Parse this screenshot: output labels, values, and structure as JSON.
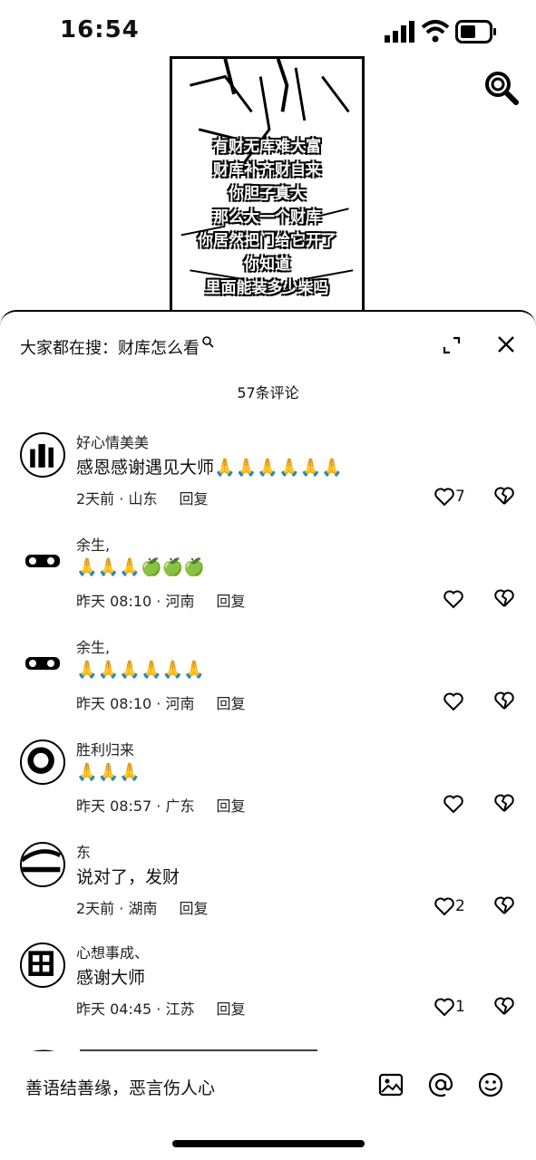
{
  "status_bar": {
    "time": "16:54"
  },
  "video": {
    "captions": [
      "有财无库难大富",
      "财库补齐财自来",
      "你胆子真大",
      "那么大一个财库",
      "你居然把门给它开了",
      "你知道",
      "里面能装多少柴吗"
    ]
  },
  "sheet": {
    "suggest_prefix": "大家都在搜：",
    "suggest_query": "财库怎么看",
    "comment_count": "57条评论",
    "comments": [
      {
        "user": "好心情美美",
        "text": "感恩感谢遇见大师🙏🙏🙏🙏🙏🙏",
        "time_loc": "2天前 · 山东",
        "reply": "回复",
        "likes": "7"
      },
      {
        "user": "余生,",
        "text": "🙏🙏🙏🍏🍏🍏",
        "time_loc": "昨天 08:10 · 河南",
        "reply": "回复",
        "likes": ""
      },
      {
        "user": "余生,",
        "text": "🙏🙏🙏🙏🙏🙏",
        "time_loc": "昨天 08:10 · 河南",
        "reply": "回复",
        "likes": ""
      },
      {
        "user": "胜利归来",
        "text": "🙏🙏🙏",
        "time_loc": "昨天 08:57 · 广东",
        "reply": "回复",
        "likes": ""
      },
      {
        "user": "东",
        "text": "说对了，发财",
        "time_loc": "2天前 · 湖南",
        "reply": "回复",
        "likes": "2"
      },
      {
        "user": "心想事成、",
        "text": "感谢大师",
        "time_loc": "昨天 04:45 · 江苏",
        "reply": "回复",
        "likes": "1"
      }
    ],
    "input_placeholder": "善语结善缘，恶言伤人心"
  }
}
